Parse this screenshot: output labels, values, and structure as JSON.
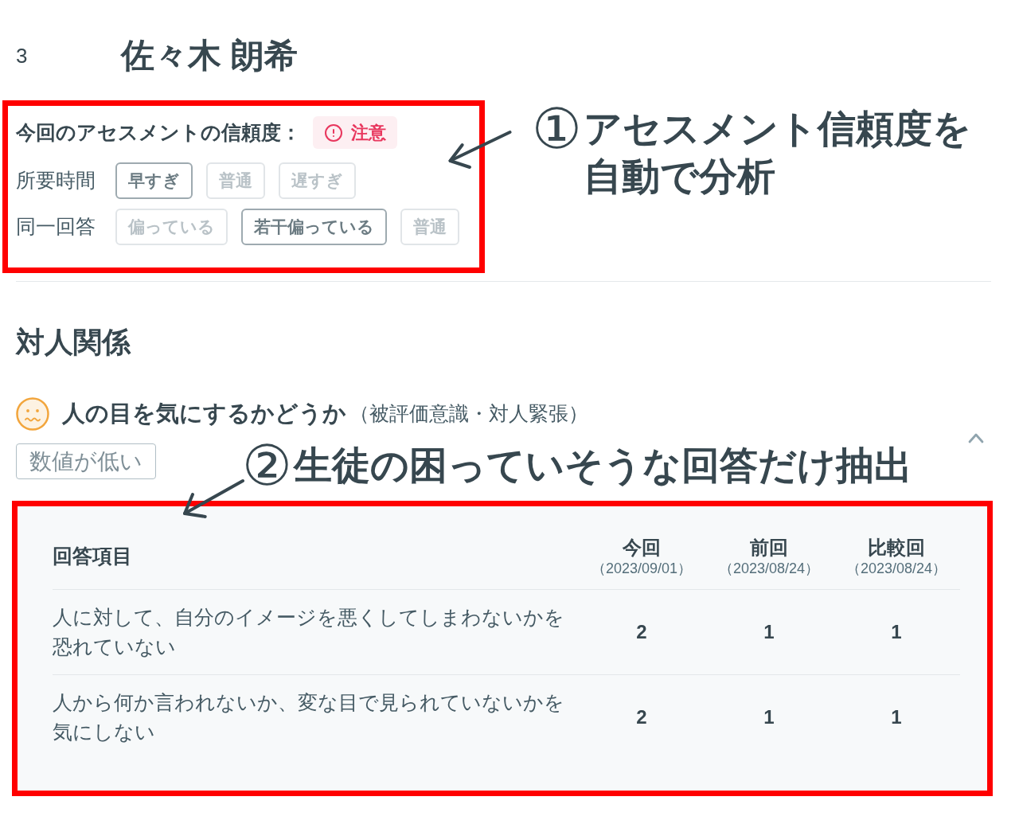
{
  "header": {
    "number": "3",
    "name": "佐々木 朗希"
  },
  "assessment": {
    "label": "今回のアセスメントの信頼度：",
    "badge": "注意",
    "criteria": [
      {
        "label": "所要時間",
        "options": [
          {
            "label": "早すぎ",
            "selected": true
          },
          {
            "label": "普通",
            "selected": false
          },
          {
            "label": "遅すぎ",
            "selected": false
          }
        ]
      },
      {
        "label": "同一回答",
        "options": [
          {
            "label": "偏っている",
            "selected": false
          },
          {
            "label": "若干偏っている",
            "selected": true
          },
          {
            "label": "普通",
            "selected": false
          }
        ]
      }
    ],
    "annotation": {
      "number": "①",
      "lines": [
        "アセスメント信頼度を",
        "自動で分析"
      ]
    }
  },
  "section": {
    "title": "対人関係",
    "item": {
      "title": "人の目を気にするかどうか",
      "subtitle": "（被評価意識・対人緊張）",
      "expanded": true,
      "tag": "数値が低い",
      "annotation": {
        "number": "②",
        "lines": [
          "生徒の困っていそうな回答だけ抽出"
        ]
      },
      "table": {
        "columns": [
          {
            "title": "回答項目"
          },
          {
            "title": "今回",
            "date": "（2023/09/01）"
          },
          {
            "title": "前回",
            "date": "（2023/08/24）"
          },
          {
            "title": "比較回",
            "date": "（2023/08/24）"
          }
        ],
        "rows": [
          {
            "item": [
              "人に対して、自分のイメージを悪くしてしまわないかを",
              "恐れていない"
            ],
            "values": [
              "2",
              "1",
              "1"
            ]
          },
          {
            "item": [
              "人から何か言われないか、変な目で見られていないかを",
              "気にしない"
            ],
            "values": [
              "2",
              "1",
              "1"
            ]
          }
        ]
      }
    }
  }
}
